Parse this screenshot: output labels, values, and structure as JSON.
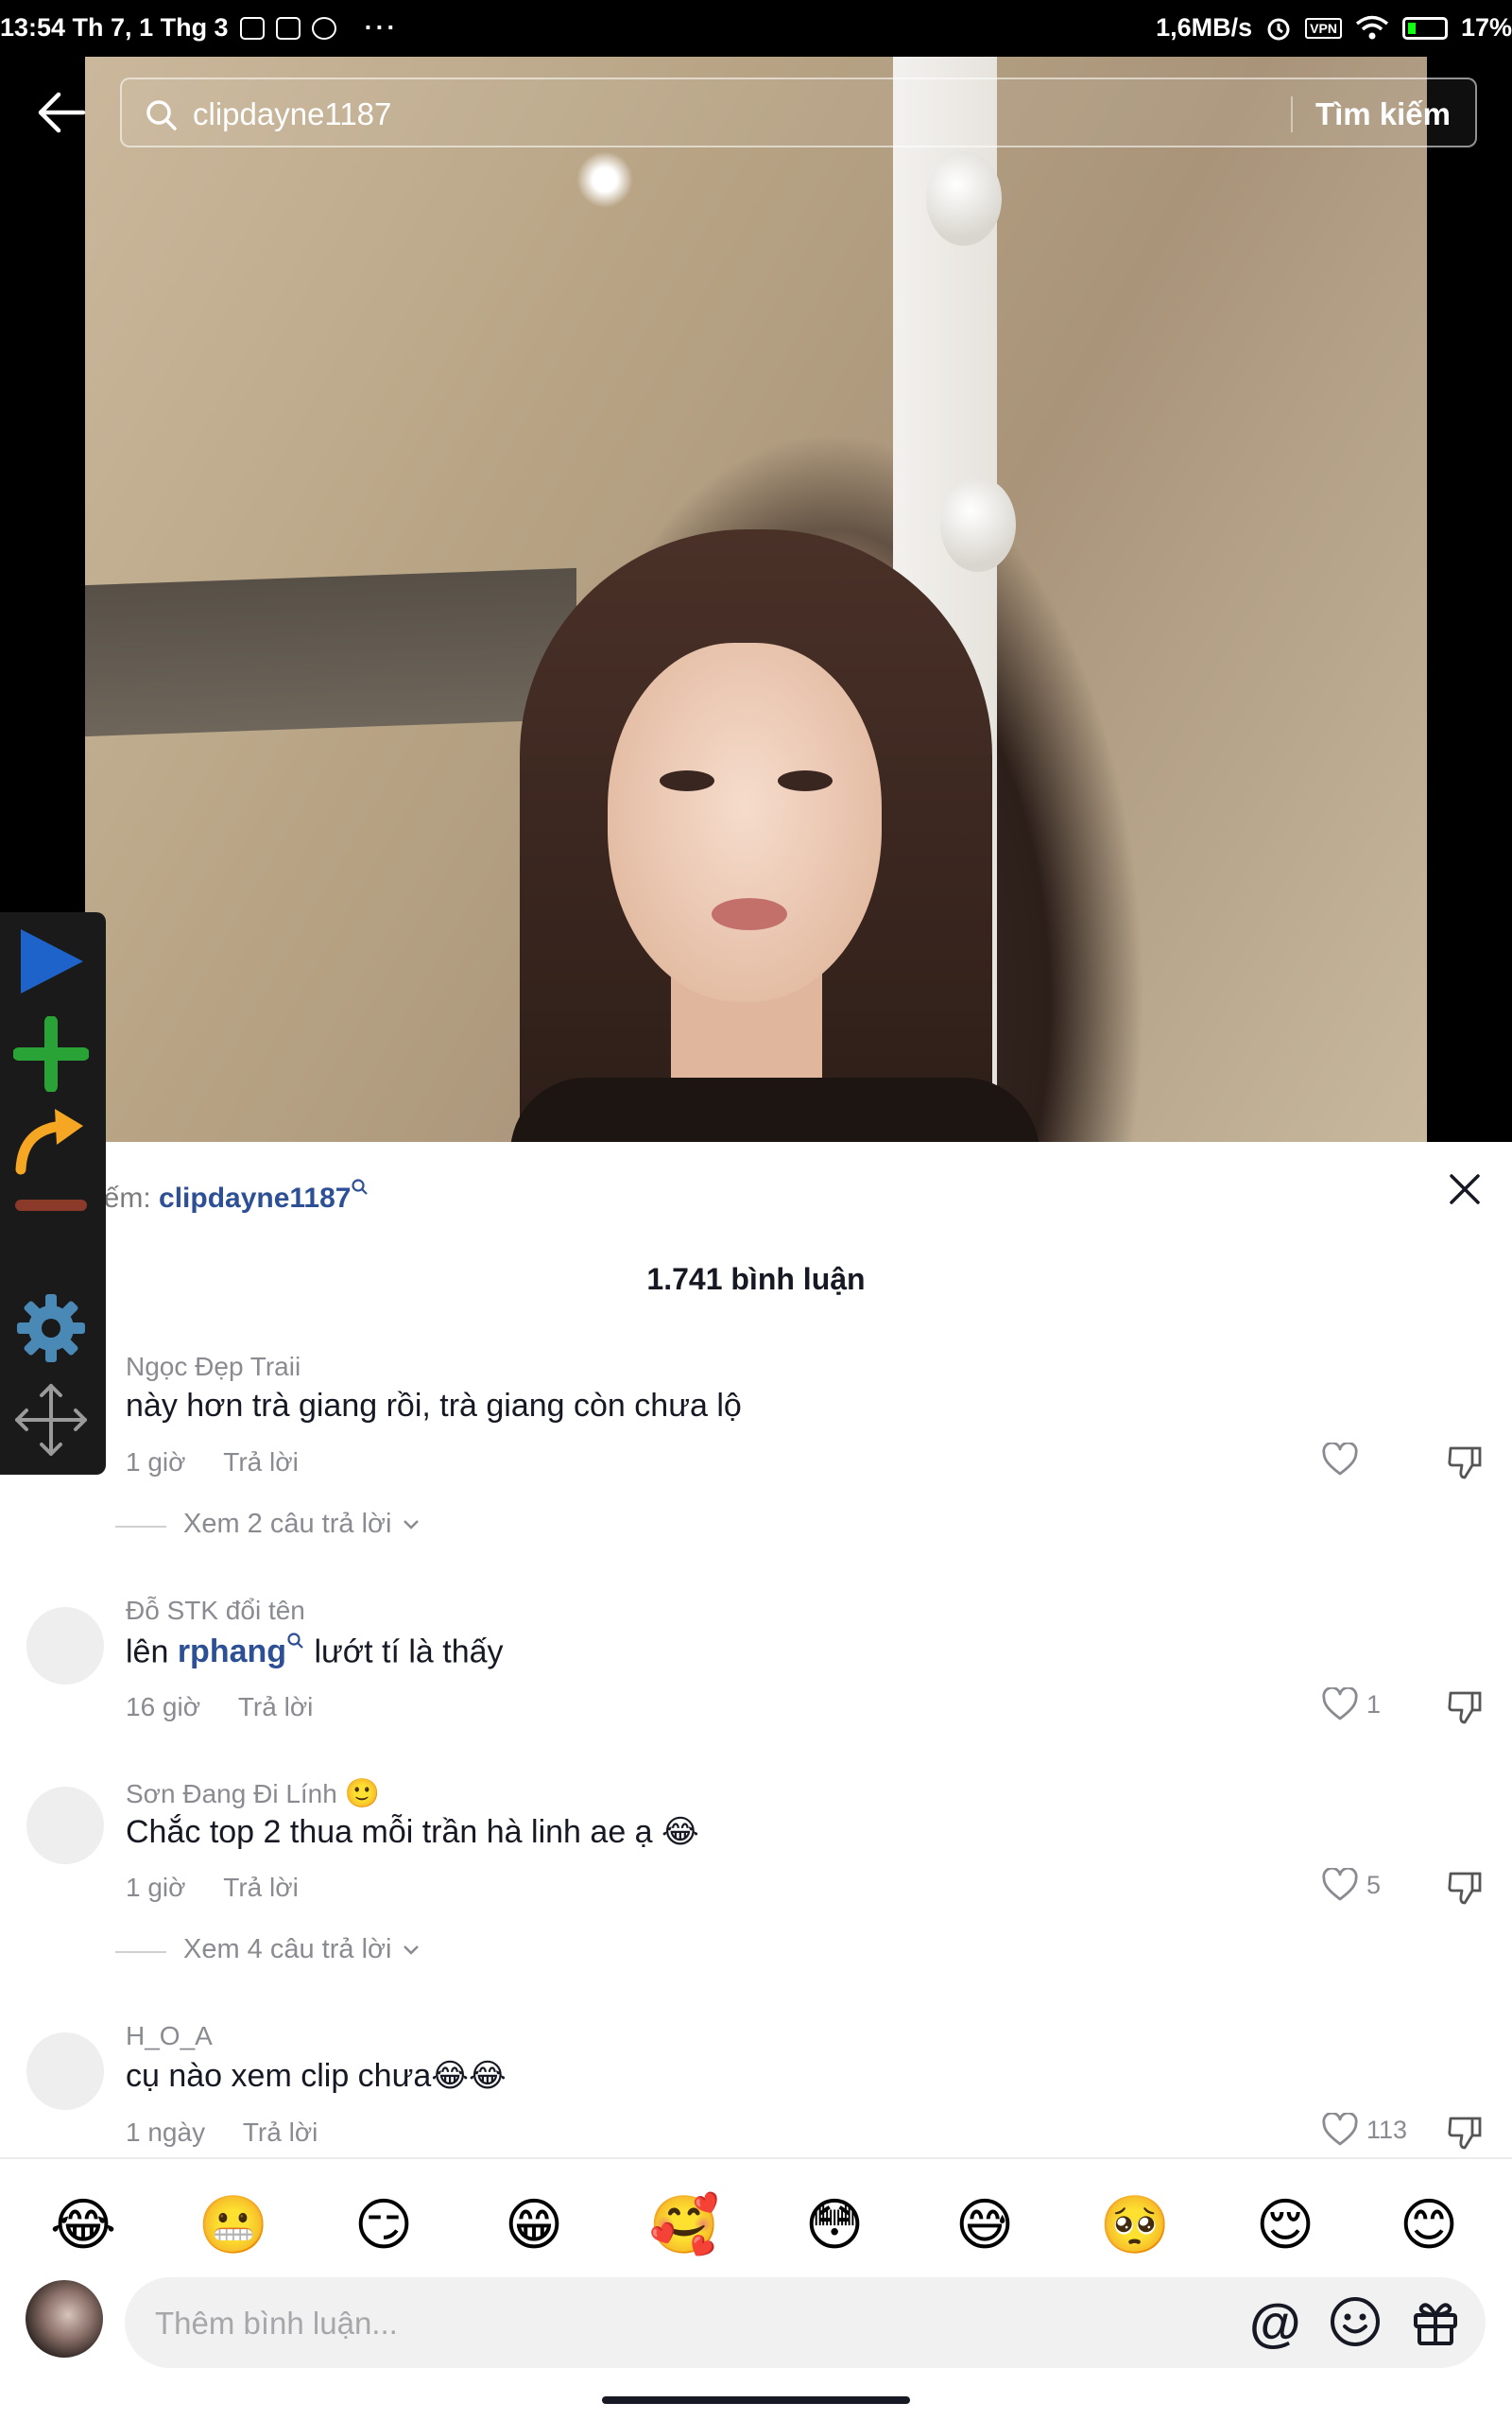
{
  "status": {
    "time_date": "13:54 Th 7, 1 Thg 3",
    "speed": "1,6MB/s",
    "vpn": "VPN",
    "battery": "17%",
    "more": "···"
  },
  "search": {
    "query": "clipdayne1187",
    "submit_label": "Tìm kiếm"
  },
  "panel": {
    "related_prefix": "Tìm kiếm:",
    "related_term": "clipdayne1187",
    "comment_count": "1.741 bình luận"
  },
  "comments": [
    {
      "user": "Ngọc Đẹp Traii",
      "text": "này hơn trà giang rồi, trà giang còn chưa lộ",
      "time": "1 giờ",
      "reply": "Trả lời",
      "likes": "",
      "view_replies": "Xem 2 câu trả lời"
    },
    {
      "user": "Đỗ STK đổi tên",
      "text_before": "lên ",
      "mention": "rphang",
      "text_after": " lướt tí là thấy",
      "time": "16 giờ",
      "reply": "Trả lời",
      "likes": "1"
    },
    {
      "user": "Sơn Đang Đi Lính",
      "user_emoji": "🙂",
      "text": "Chắc top 2 thua mỗi trần hà linh ae ạ 😂",
      "time": "1 giờ",
      "reply": "Trả lời",
      "likes": "5",
      "view_replies": "Xem 4 câu trả lời"
    },
    {
      "user": "H_O_A",
      "text": "cụ nào xem clip chưa😂😂",
      "time": "1 ngày",
      "reply": "Trả lời",
      "likes": "113"
    }
  ],
  "emoji_row": [
    "😂",
    "😬",
    "😏",
    "😁",
    "🥰",
    "😳",
    "😅",
    "🥺",
    "😌",
    "😊"
  ],
  "input": {
    "placeholder": "Thêm bình luận...",
    "at": "@"
  },
  "toolbar_icons": [
    "play-icon",
    "plus-icon",
    "redo-arrow-icon",
    "minus-icon",
    "gear-icon",
    "move-icon"
  ],
  "colors": {
    "link": "#2c4f95",
    "muted": "#8a8b91",
    "text": "#161823",
    "toolbar_play": "#1e63c9",
    "toolbar_plus": "#2aa336",
    "toolbar_redo": "#f5a623",
    "toolbar_minus": "#8b3a2a",
    "toolbar_gear": "#4a89b5"
  }
}
